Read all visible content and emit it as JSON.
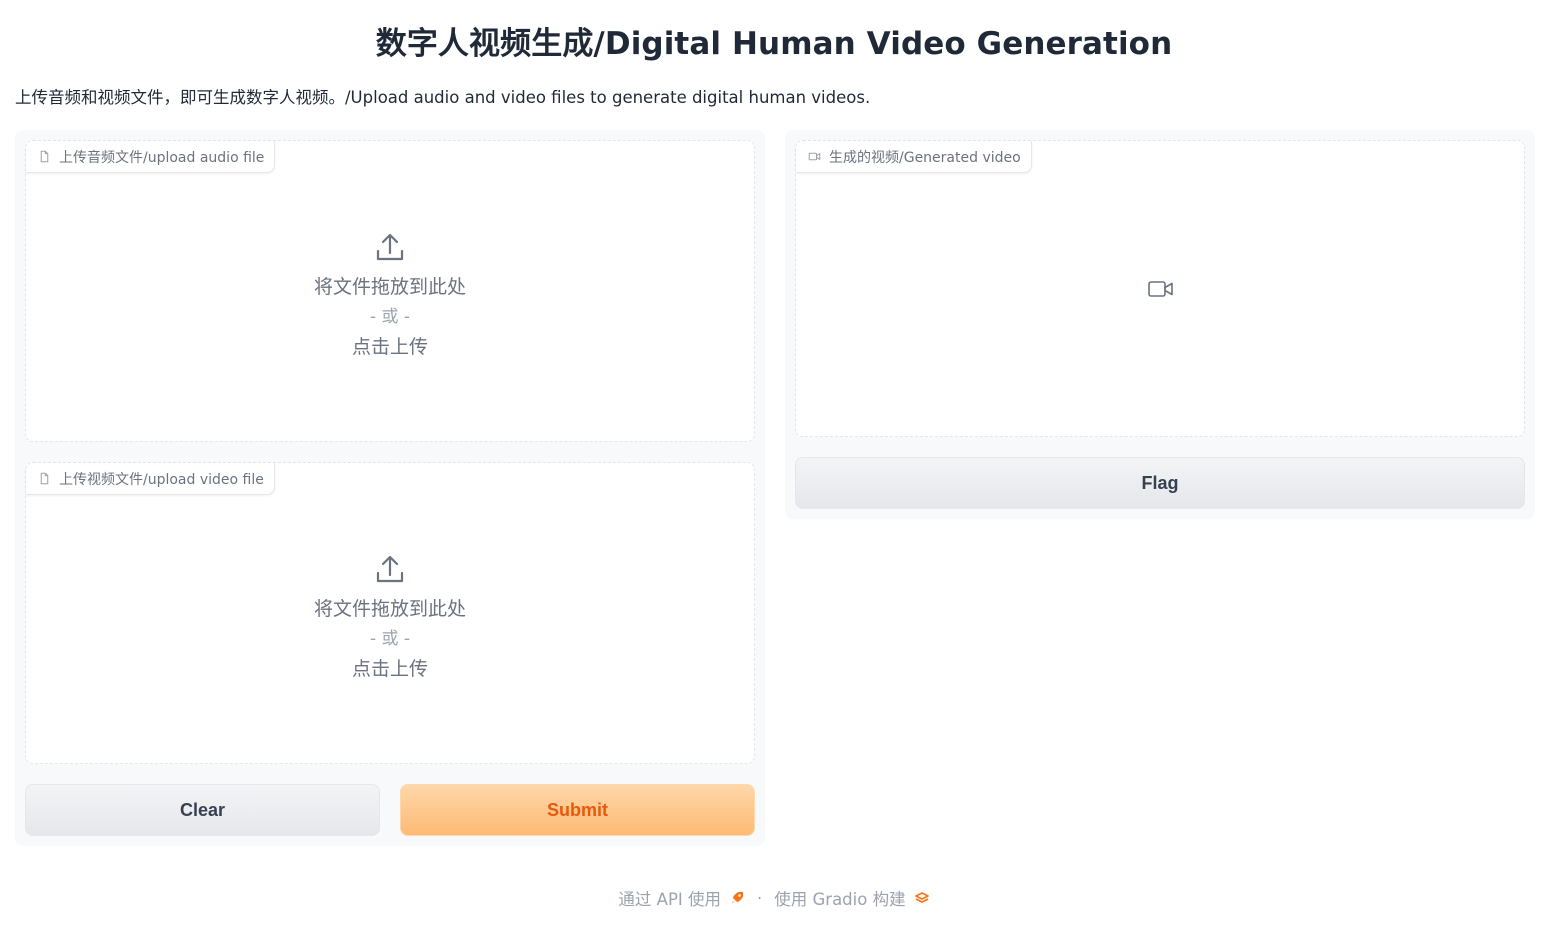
{
  "header": {
    "title": "数字人视频生成/Digital Human Video Generation",
    "description": "上传音频和视频文件，即可生成数字人视频。/Upload audio and video files to generate digital human videos."
  },
  "inputs": {
    "audio": {
      "label": "上传音频文件/upload audio file",
      "drop_text": "将文件拖放到此处",
      "or_text": "- 或 -",
      "click_text": "点击上传",
      "icon": "upload-icon"
    },
    "video": {
      "label": "上传视频文件/upload video file",
      "drop_text": "将文件拖放到此处",
      "or_text": "- 或 -",
      "click_text": "点击上传",
      "icon": "upload-icon"
    },
    "clear_label": "Clear",
    "submit_label": "Submit"
  },
  "output": {
    "label": "生成的视频/Generated video",
    "icon": "video-camera-icon",
    "flag_label": "Flag"
  },
  "footer": {
    "api_text": "通过 API 使用",
    "separator": "·",
    "built_text": "使用 Gradio 构建"
  },
  "colors": {
    "accent": "#ea580c",
    "submit_bg": "#fdba74",
    "panel_bg": "#f8f9fb"
  }
}
